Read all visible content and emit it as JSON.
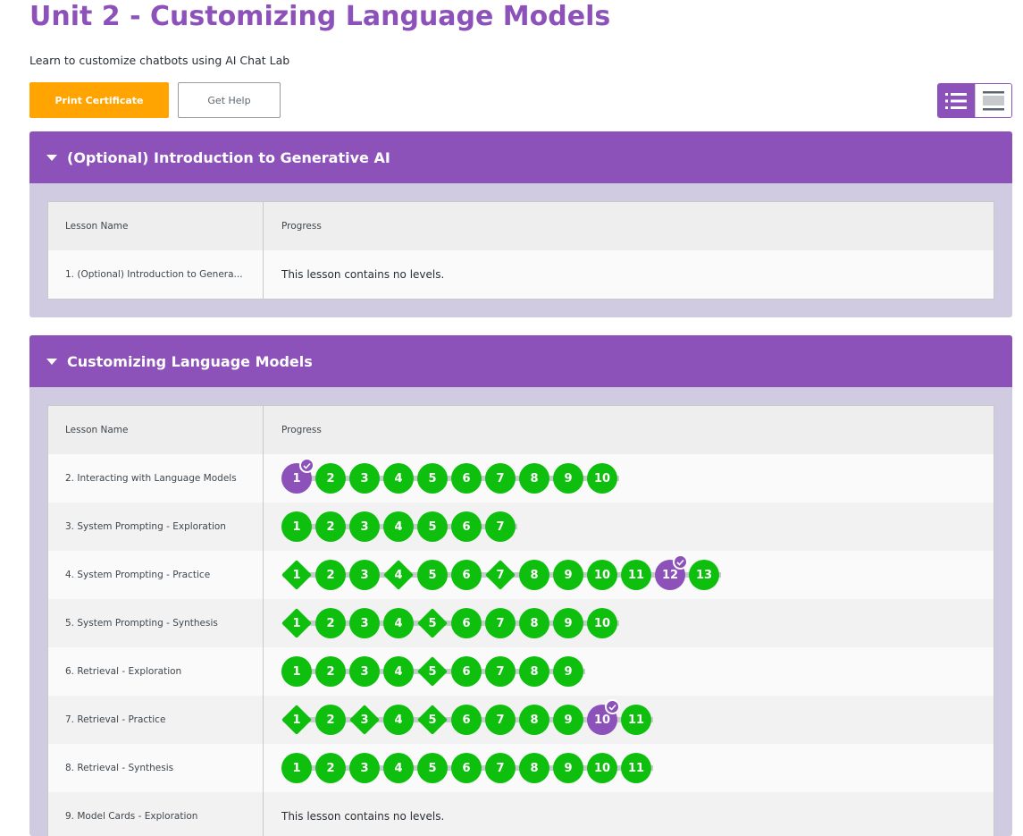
{
  "page": {
    "title": "Unit 2 - Customizing Language Models",
    "subtitle": "Learn to customize chatbots using AI Chat Lab",
    "print_certificate": "Print Certificate",
    "get_help": "Get Help"
  },
  "colors": {
    "accent": "#8c52ba",
    "complete": "#0ebf0e",
    "button": "#ffa400"
  },
  "icons": [
    "caret-down-icon",
    "list-view-icon",
    "summary-view-icon",
    "checkmark-icon"
  ],
  "sections": [
    {
      "title": "(Optional) Introduction to Generative AI",
      "columns": [
        "Lesson Name",
        "Progress"
      ],
      "lessons": [
        {
          "name": "1. (Optional) Introduction to Genera...",
          "no_levels": "This lesson contains no levels.",
          "levels": []
        }
      ]
    },
    {
      "title": "Customizing Language Models",
      "columns": [
        "Lesson Name",
        "Progress"
      ],
      "lessons": [
        {
          "name": "2. Interacting with Language Models",
          "levels": [
            {
              "n": "1",
              "shape": "circle",
              "state": "submitted"
            },
            {
              "n": "2",
              "shape": "circle",
              "state": "complete"
            },
            {
              "n": "3",
              "shape": "circle",
              "state": "complete"
            },
            {
              "n": "4",
              "shape": "circle",
              "state": "complete"
            },
            {
              "n": "5",
              "shape": "circle",
              "state": "complete"
            },
            {
              "n": "6",
              "shape": "circle",
              "state": "complete"
            },
            {
              "n": "7",
              "shape": "circle",
              "state": "complete"
            },
            {
              "n": "8",
              "shape": "circle",
              "state": "complete"
            },
            {
              "n": "9",
              "shape": "circle",
              "state": "complete"
            },
            {
              "n": "10",
              "shape": "circle",
              "state": "complete"
            }
          ]
        },
        {
          "name": "3. System Prompting - Exploration",
          "levels": [
            {
              "n": "1",
              "shape": "circle",
              "state": "complete"
            },
            {
              "n": "2",
              "shape": "circle",
              "state": "complete"
            },
            {
              "n": "3",
              "shape": "circle",
              "state": "complete"
            },
            {
              "n": "4",
              "shape": "circle",
              "state": "complete"
            },
            {
              "n": "5",
              "shape": "circle",
              "state": "complete"
            },
            {
              "n": "6",
              "shape": "circle",
              "state": "complete"
            },
            {
              "n": "7",
              "shape": "circle",
              "state": "complete"
            }
          ]
        },
        {
          "name": "4. System Prompting - Practice",
          "levels": [
            {
              "n": "1",
              "shape": "diamond",
              "state": "complete"
            },
            {
              "n": "2",
              "shape": "circle",
              "state": "complete"
            },
            {
              "n": "3",
              "shape": "circle",
              "state": "complete"
            },
            {
              "n": "4",
              "shape": "diamond",
              "state": "complete"
            },
            {
              "n": "5",
              "shape": "circle",
              "state": "complete"
            },
            {
              "n": "6",
              "shape": "circle",
              "state": "complete"
            },
            {
              "n": "7",
              "shape": "diamond",
              "state": "complete"
            },
            {
              "n": "8",
              "shape": "circle",
              "state": "complete"
            },
            {
              "n": "9",
              "shape": "circle",
              "state": "complete"
            },
            {
              "n": "10",
              "shape": "circle",
              "state": "complete"
            },
            {
              "n": "11",
              "shape": "circle",
              "state": "complete"
            },
            {
              "n": "12",
              "shape": "circle",
              "state": "submitted"
            },
            {
              "n": "13",
              "shape": "circle",
              "state": "complete"
            }
          ]
        },
        {
          "name": "5. System Prompting - Synthesis",
          "levels": [
            {
              "n": "1",
              "shape": "diamond",
              "state": "complete"
            },
            {
              "n": "2",
              "shape": "circle",
              "state": "complete"
            },
            {
              "n": "3",
              "shape": "circle",
              "state": "complete"
            },
            {
              "n": "4",
              "shape": "circle",
              "state": "complete"
            },
            {
              "n": "5",
              "shape": "diamond",
              "state": "complete"
            },
            {
              "n": "6",
              "shape": "circle",
              "state": "complete"
            },
            {
              "n": "7",
              "shape": "circle",
              "state": "complete"
            },
            {
              "n": "8",
              "shape": "circle",
              "state": "complete"
            },
            {
              "n": "9",
              "shape": "circle",
              "state": "complete"
            },
            {
              "n": "10",
              "shape": "circle",
              "state": "complete"
            }
          ]
        },
        {
          "name": "6. Retrieval - Exploration",
          "levels": [
            {
              "n": "1",
              "shape": "circle",
              "state": "complete"
            },
            {
              "n": "2",
              "shape": "circle",
              "state": "complete"
            },
            {
              "n": "3",
              "shape": "circle",
              "state": "complete"
            },
            {
              "n": "4",
              "shape": "circle",
              "state": "complete"
            },
            {
              "n": "5",
              "shape": "diamond",
              "state": "complete"
            },
            {
              "n": "6",
              "shape": "circle",
              "state": "complete"
            },
            {
              "n": "7",
              "shape": "circle",
              "state": "complete"
            },
            {
              "n": "8",
              "shape": "circle",
              "state": "complete"
            },
            {
              "n": "9",
              "shape": "circle",
              "state": "complete"
            }
          ]
        },
        {
          "name": "7. Retrieval - Practice",
          "levels": [
            {
              "n": "1",
              "shape": "diamond",
              "state": "complete"
            },
            {
              "n": "2",
              "shape": "circle",
              "state": "complete"
            },
            {
              "n": "3",
              "shape": "diamond",
              "state": "complete"
            },
            {
              "n": "4",
              "shape": "circle",
              "state": "complete"
            },
            {
              "n": "5",
              "shape": "diamond",
              "state": "complete"
            },
            {
              "n": "6",
              "shape": "circle",
              "state": "complete"
            },
            {
              "n": "7",
              "shape": "circle",
              "state": "complete"
            },
            {
              "n": "8",
              "shape": "circle",
              "state": "complete"
            },
            {
              "n": "9",
              "shape": "circle",
              "state": "complete"
            },
            {
              "n": "10",
              "shape": "circle",
              "state": "submitted"
            },
            {
              "n": "11",
              "shape": "circle",
              "state": "complete"
            }
          ]
        },
        {
          "name": "8. Retrieval - Synthesis",
          "levels": [
            {
              "n": "1",
              "shape": "circle",
              "state": "complete"
            },
            {
              "n": "2",
              "shape": "circle",
              "state": "complete"
            },
            {
              "n": "3",
              "shape": "circle",
              "state": "complete"
            },
            {
              "n": "4",
              "shape": "circle",
              "state": "complete"
            },
            {
              "n": "5",
              "shape": "circle",
              "state": "complete"
            },
            {
              "n": "6",
              "shape": "circle",
              "state": "complete"
            },
            {
              "n": "7",
              "shape": "circle",
              "state": "complete"
            },
            {
              "n": "8",
              "shape": "circle",
              "state": "complete"
            },
            {
              "n": "9",
              "shape": "circle",
              "state": "complete"
            },
            {
              "n": "10",
              "shape": "circle",
              "state": "complete"
            },
            {
              "n": "11",
              "shape": "circle",
              "state": "complete"
            }
          ]
        },
        {
          "name": "9. Model Cards - Exploration",
          "no_levels": "This lesson contains no levels.",
          "levels": []
        }
      ]
    }
  ]
}
